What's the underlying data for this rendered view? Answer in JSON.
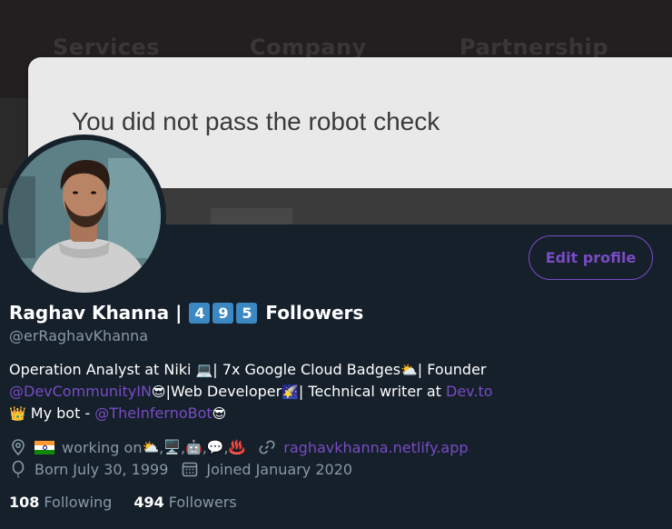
{
  "banner": {
    "nav": [
      "Services",
      "Company",
      "Partnership"
    ],
    "card_text": "You did not pass the robot check"
  },
  "profile": {
    "name": "Raghav Khanna |",
    "follower_digits": [
      "4",
      "9",
      "5"
    ],
    "name_suffix": "Followers",
    "handle": "@erRaghavKhanna",
    "edit_button": "Edit profile",
    "bio": {
      "line1_text": "Operation Analyst at Niki ",
      "line1_emoji1": "💻",
      "line1_text2": "| 7x Google Cloud Badges",
      "line1_emoji2": "⛅",
      "line1_text3": "| Founder",
      "line2_link": "@DevCommunityIN",
      "line2_emoji1": "😎",
      "line2_text": "|Web Developer",
      "line2_emoji2": "🌠",
      "line2_text2": "| Technical writer at ",
      "line2_link2": "Dev.to",
      "line3_emoji1": "👑",
      "line3_text": " My bot - ",
      "line3_link": "@TheInfernoBot",
      "line3_emoji2": "😎"
    },
    "location": {
      "flag_icon": "india-flag-icon",
      "text": "working on ",
      "emojis": [
        "⛅",
        "🖥️",
        "🤖",
        "💬",
        "♨️"
      ]
    },
    "website": "raghavkhanna.netlify.app",
    "birthday": "Born July 30, 1999",
    "joined": "Joined January 2020",
    "following_count": "108",
    "following_label": "Following",
    "followers_count": "494",
    "followers_label": "Followers"
  },
  "colors": {
    "background": "#15202b",
    "accent": "#794bc4",
    "secondary_text": "#8899a6",
    "keycap_blue": "#3b88c3"
  }
}
